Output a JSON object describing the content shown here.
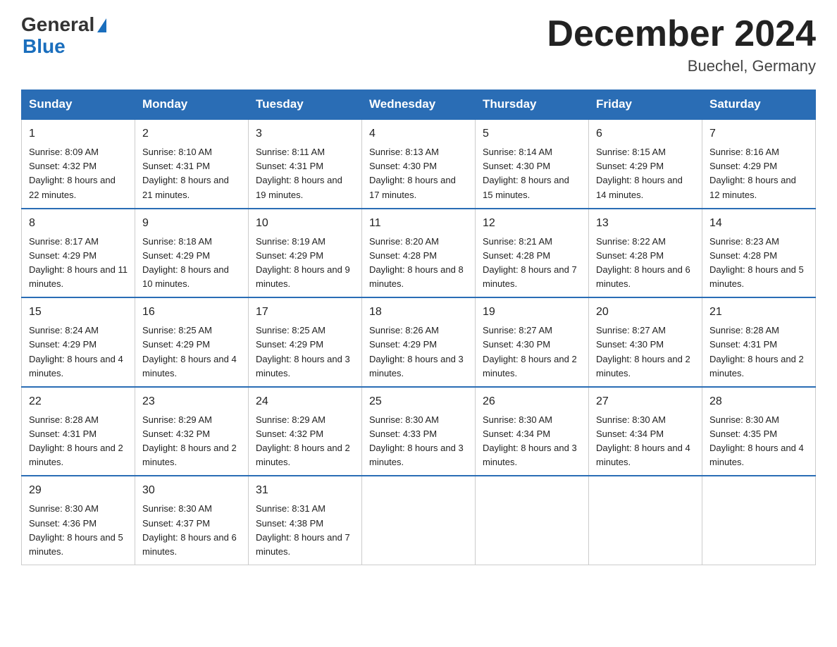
{
  "header": {
    "logo_general": "General",
    "logo_blue": "Blue",
    "month_title": "December 2024",
    "location": "Buechel, Germany"
  },
  "days_of_week": [
    "Sunday",
    "Monday",
    "Tuesday",
    "Wednesday",
    "Thursday",
    "Friday",
    "Saturday"
  ],
  "weeks": [
    [
      {
        "day": "1",
        "sunrise": "8:09 AM",
        "sunset": "4:32 PM",
        "daylight": "8 hours and 22 minutes."
      },
      {
        "day": "2",
        "sunrise": "8:10 AM",
        "sunset": "4:31 PM",
        "daylight": "8 hours and 21 minutes."
      },
      {
        "day": "3",
        "sunrise": "8:11 AM",
        "sunset": "4:31 PM",
        "daylight": "8 hours and 19 minutes."
      },
      {
        "day": "4",
        "sunrise": "8:13 AM",
        "sunset": "4:30 PM",
        "daylight": "8 hours and 17 minutes."
      },
      {
        "day": "5",
        "sunrise": "8:14 AM",
        "sunset": "4:30 PM",
        "daylight": "8 hours and 15 minutes."
      },
      {
        "day": "6",
        "sunrise": "8:15 AM",
        "sunset": "4:29 PM",
        "daylight": "8 hours and 14 minutes."
      },
      {
        "day": "7",
        "sunrise": "8:16 AM",
        "sunset": "4:29 PM",
        "daylight": "8 hours and 12 minutes."
      }
    ],
    [
      {
        "day": "8",
        "sunrise": "8:17 AM",
        "sunset": "4:29 PM",
        "daylight": "8 hours and 11 minutes."
      },
      {
        "day": "9",
        "sunrise": "8:18 AM",
        "sunset": "4:29 PM",
        "daylight": "8 hours and 10 minutes."
      },
      {
        "day": "10",
        "sunrise": "8:19 AM",
        "sunset": "4:29 PM",
        "daylight": "8 hours and 9 minutes."
      },
      {
        "day": "11",
        "sunrise": "8:20 AM",
        "sunset": "4:28 PM",
        "daylight": "8 hours and 8 minutes."
      },
      {
        "day": "12",
        "sunrise": "8:21 AM",
        "sunset": "4:28 PM",
        "daylight": "8 hours and 7 minutes."
      },
      {
        "day": "13",
        "sunrise": "8:22 AM",
        "sunset": "4:28 PM",
        "daylight": "8 hours and 6 minutes."
      },
      {
        "day": "14",
        "sunrise": "8:23 AM",
        "sunset": "4:28 PM",
        "daylight": "8 hours and 5 minutes."
      }
    ],
    [
      {
        "day": "15",
        "sunrise": "8:24 AM",
        "sunset": "4:29 PM",
        "daylight": "8 hours and 4 minutes."
      },
      {
        "day": "16",
        "sunrise": "8:25 AM",
        "sunset": "4:29 PM",
        "daylight": "8 hours and 4 minutes."
      },
      {
        "day": "17",
        "sunrise": "8:25 AM",
        "sunset": "4:29 PM",
        "daylight": "8 hours and 3 minutes."
      },
      {
        "day": "18",
        "sunrise": "8:26 AM",
        "sunset": "4:29 PM",
        "daylight": "8 hours and 3 minutes."
      },
      {
        "day": "19",
        "sunrise": "8:27 AM",
        "sunset": "4:30 PM",
        "daylight": "8 hours and 2 minutes."
      },
      {
        "day": "20",
        "sunrise": "8:27 AM",
        "sunset": "4:30 PM",
        "daylight": "8 hours and 2 minutes."
      },
      {
        "day": "21",
        "sunrise": "8:28 AM",
        "sunset": "4:31 PM",
        "daylight": "8 hours and 2 minutes."
      }
    ],
    [
      {
        "day": "22",
        "sunrise": "8:28 AM",
        "sunset": "4:31 PM",
        "daylight": "8 hours and 2 minutes."
      },
      {
        "day": "23",
        "sunrise": "8:29 AM",
        "sunset": "4:32 PM",
        "daylight": "8 hours and 2 minutes."
      },
      {
        "day": "24",
        "sunrise": "8:29 AM",
        "sunset": "4:32 PM",
        "daylight": "8 hours and 2 minutes."
      },
      {
        "day": "25",
        "sunrise": "8:30 AM",
        "sunset": "4:33 PM",
        "daylight": "8 hours and 3 minutes."
      },
      {
        "day": "26",
        "sunrise": "8:30 AM",
        "sunset": "4:34 PM",
        "daylight": "8 hours and 3 minutes."
      },
      {
        "day": "27",
        "sunrise": "8:30 AM",
        "sunset": "4:34 PM",
        "daylight": "8 hours and 4 minutes."
      },
      {
        "day": "28",
        "sunrise": "8:30 AM",
        "sunset": "4:35 PM",
        "daylight": "8 hours and 4 minutes."
      }
    ],
    [
      {
        "day": "29",
        "sunrise": "8:30 AM",
        "sunset": "4:36 PM",
        "daylight": "8 hours and 5 minutes."
      },
      {
        "day": "30",
        "sunrise": "8:30 AM",
        "sunset": "4:37 PM",
        "daylight": "8 hours and 6 minutes."
      },
      {
        "day": "31",
        "sunrise": "8:31 AM",
        "sunset": "4:38 PM",
        "daylight": "8 hours and 7 minutes."
      },
      null,
      null,
      null,
      null
    ]
  ]
}
